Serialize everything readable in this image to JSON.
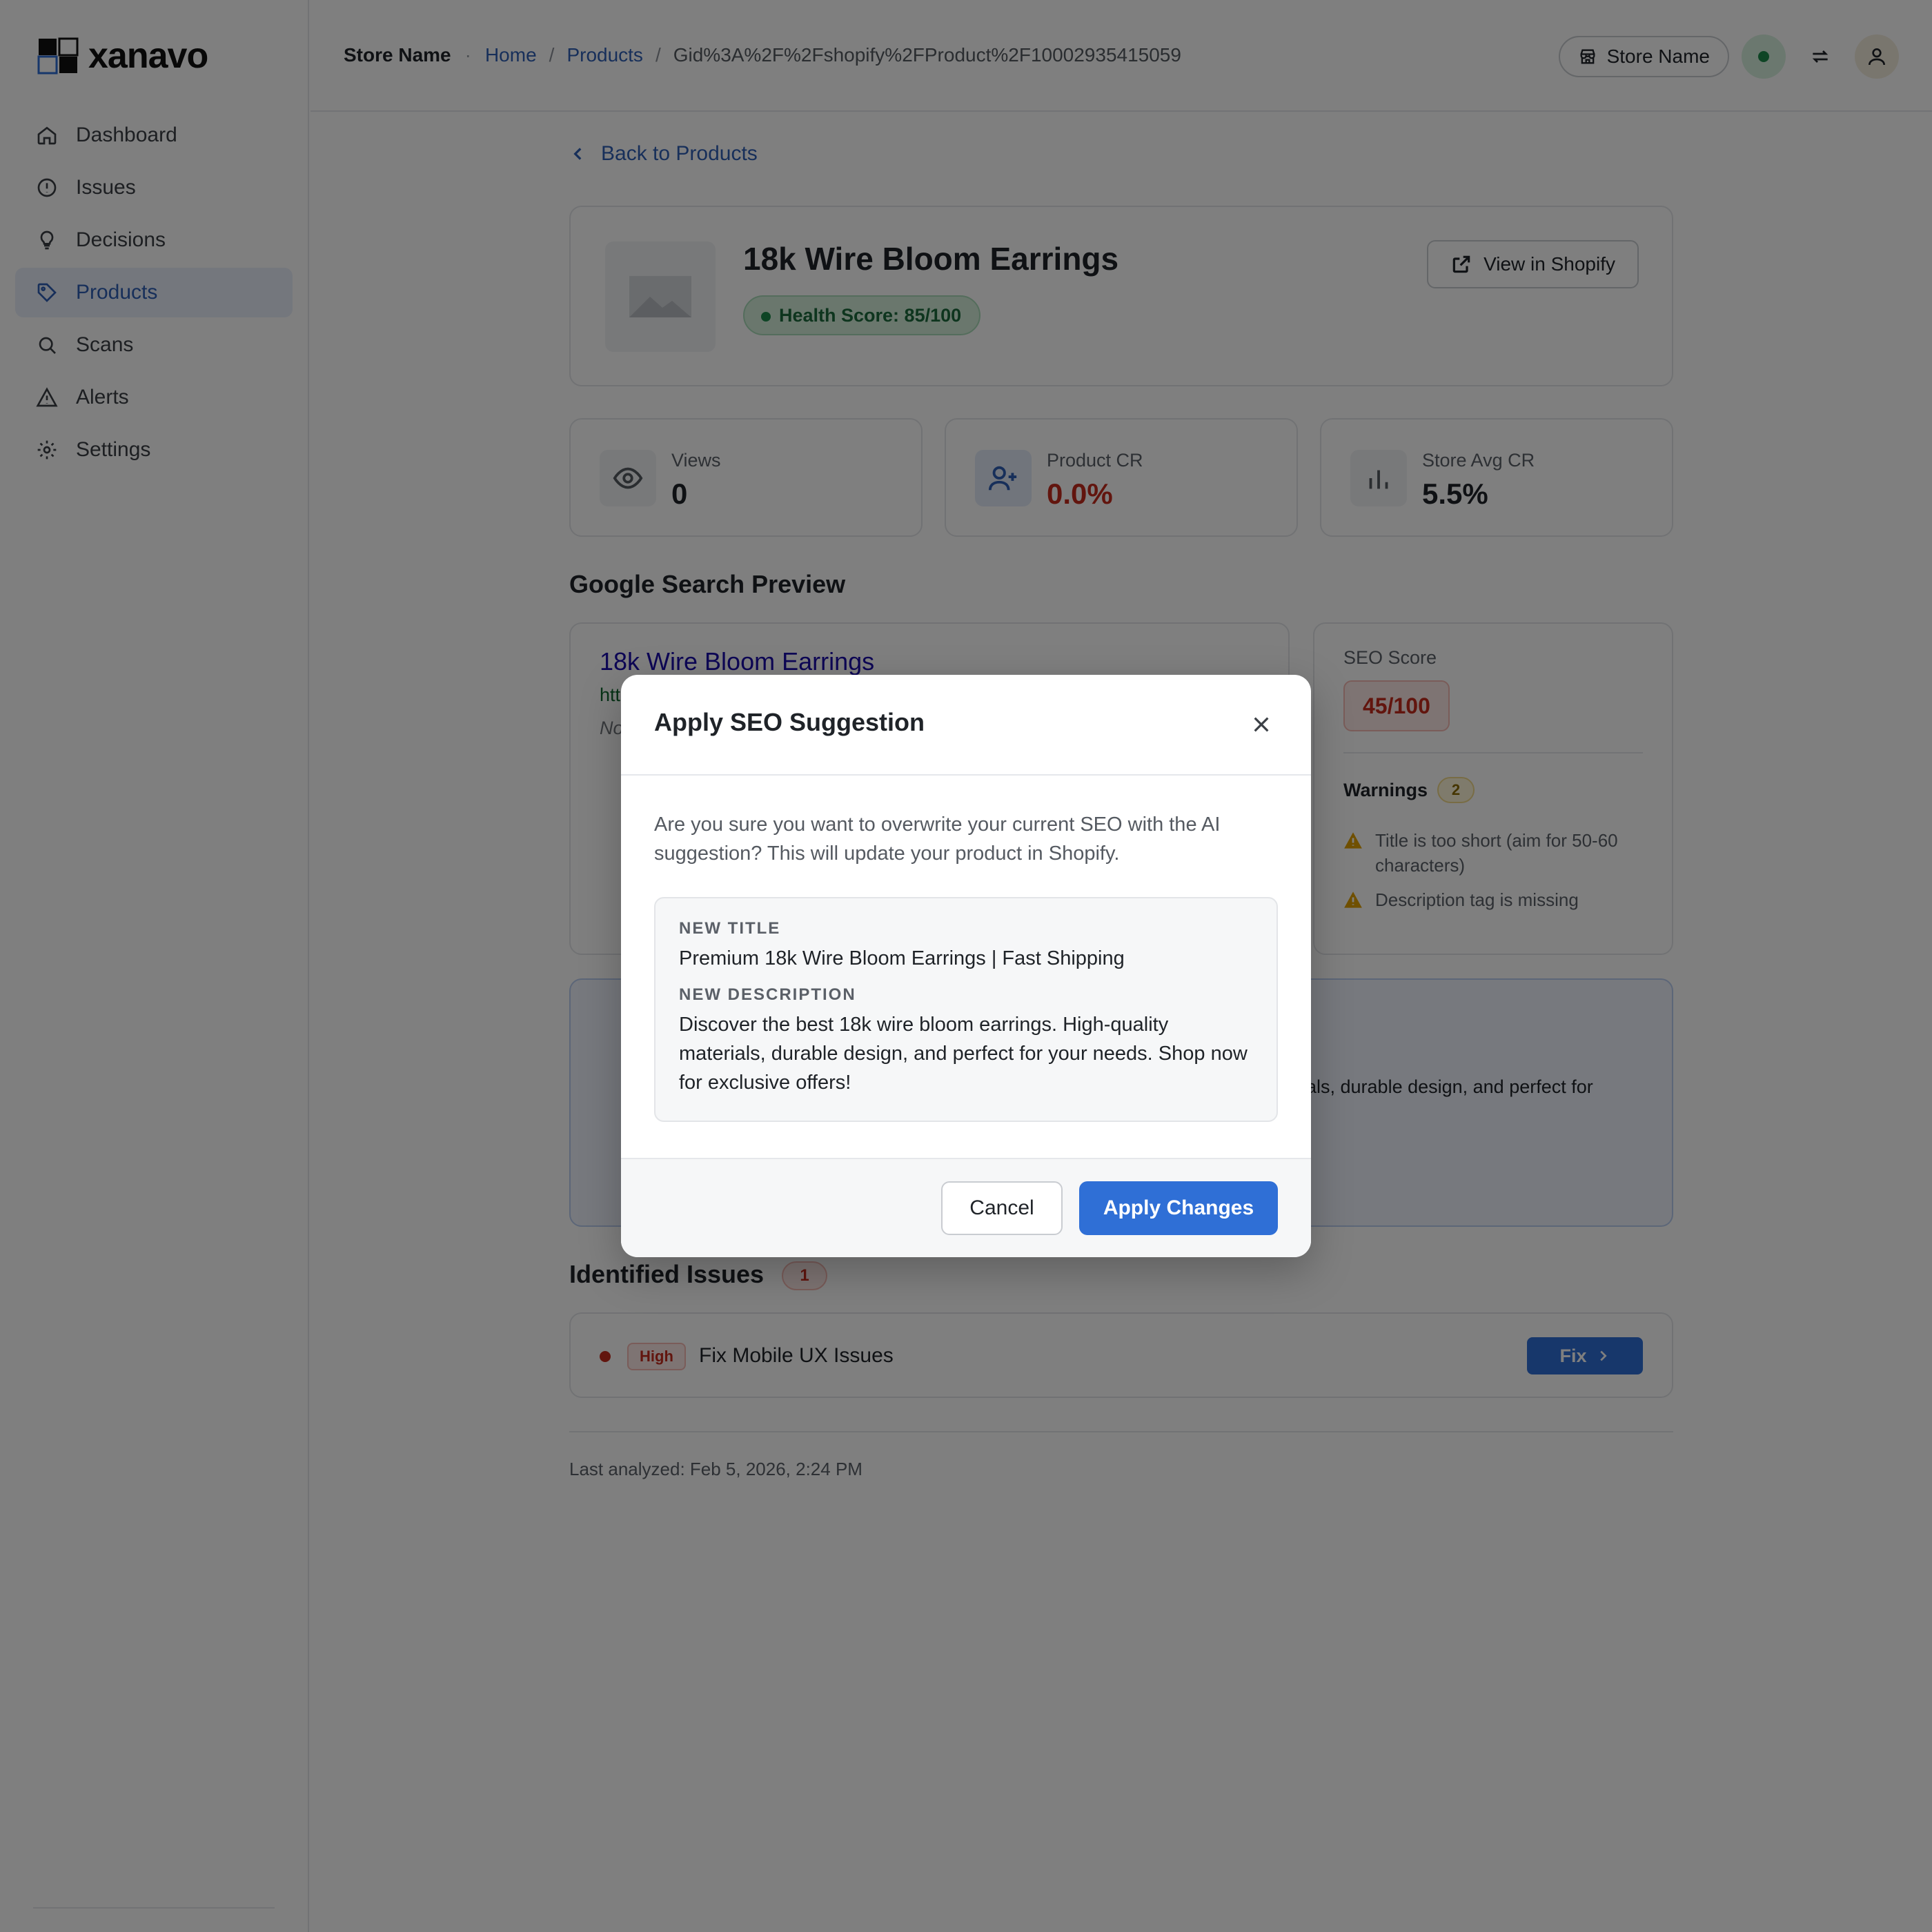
{
  "app": {
    "brand": "xanavo",
    "accent": "#2f6fd6"
  },
  "sidebar": {
    "items": [
      {
        "label": "Dashboard",
        "icon": "home-icon"
      },
      {
        "label": "Issues",
        "icon": "alert-circle-icon"
      },
      {
        "label": "Decisions",
        "icon": "lightbulb-icon"
      },
      {
        "label": "Products",
        "icon": "tag-icon",
        "active": true
      },
      {
        "label": "Scans",
        "icon": "search-icon"
      },
      {
        "label": "Alerts",
        "icon": "warning-triangle-icon"
      },
      {
        "label": "Settings",
        "icon": "gear-icon"
      }
    ]
  },
  "header": {
    "store_name": "Store Name",
    "breadcrumb": [
      "Home",
      "Products",
      "Gid%3A%2F%2Fshopify%2FProduct%2F10002935415059"
    ],
    "store_button": "Store Name"
  },
  "page": {
    "back_label": "Back to Products",
    "product_title": "18k Wire Bloom Earrings",
    "health_score": "Health Score: 85/100",
    "view_button": "View in Shopify",
    "stats": [
      {
        "label": "Views",
        "value": "0",
        "icon": "eye-icon"
      },
      {
        "label": "Product CR",
        "value": "0.0%",
        "icon": "user-plus-icon"
      },
      {
        "label": "Store Avg CR",
        "value": "5.5%",
        "icon": "bar-chart-icon"
      }
    ],
    "gsp_heading": "Google Search Preview",
    "gsp": {
      "title": "18k Wire Bloom Earrings",
      "url": "htt",
      "desc": "No"
    },
    "seo": {
      "label": "SEO Score",
      "score": "45/100",
      "warnings_label": "Warnings",
      "warnings_count": "2",
      "warnings": [
        "Title is too short (aim for 50-60 characters)",
        "Description tag is missing"
      ]
    },
    "ai_fragment": "ials, durable design, and perfect for",
    "issues_heading": "Identified Issues",
    "issues_count": "1",
    "issues": [
      {
        "severity": "High",
        "name": "Fix Mobile UX Issues",
        "action": "Fix"
      }
    ],
    "last_analyzed": "Last analyzed: Feb 5, 2026, 2:24 PM"
  },
  "modal": {
    "title": "Apply SEO Suggestion",
    "message": "Are you sure you want to overwrite your current SEO with the AI suggestion? This will update your product in Shopify.",
    "new_title_label": "NEW TITLE",
    "new_title": "Premium 18k Wire Bloom Earrings | Fast Shipping",
    "new_desc_label": "NEW DESCRIPTION",
    "new_desc": "Discover the best 18k wire bloom earrings. High-quality materials, durable design, and perfect for your needs. Shop now for exclusive offers!",
    "cancel": "Cancel",
    "apply": "Apply Changes"
  }
}
